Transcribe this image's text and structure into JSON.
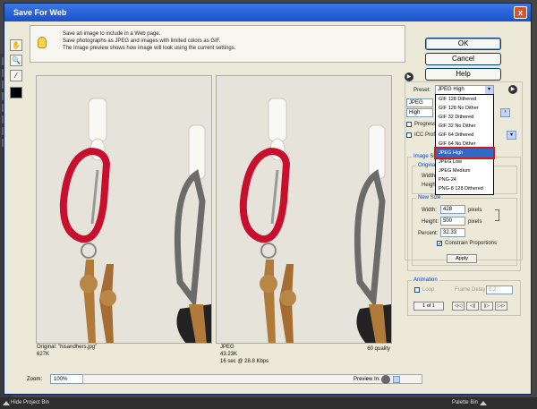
{
  "app": {
    "bottom_left": "Hide Project Bin",
    "bottom_right": "Palette Bin"
  },
  "dialog": {
    "title": "Save For Web",
    "close_glyph": "x",
    "hint_lines": [
      "Save an image to include in a Web page.",
      "Save photographs as JPEG and images with limited colors as GIF.",
      "The Image preview shows how image will look using the current settings."
    ]
  },
  "buttons": {
    "ok": "OK",
    "cancel": "Cancel",
    "help": "Help"
  },
  "preview": {
    "original": {
      "name": "Original: \"hisandhers.jpg\"",
      "size": "627K"
    },
    "optimized": {
      "format": "JPEG",
      "size": "43.23K",
      "time": "16 sec @ 28.8 Kbps",
      "quality": "60 quality"
    }
  },
  "zoom": {
    "label": "Zoom:",
    "value": "100%"
  },
  "preview_in": {
    "label": "Preview In:"
  },
  "preset": {
    "label": "Preset:",
    "value": "JPEG High",
    "format_value": "JPEG",
    "quality_value": "High",
    "progressive_label": "Progressive",
    "icc_label": "ICC Profile",
    "options": [
      "GIF 128 Dithered",
      "GIF 128 No Dither",
      "GIF 32 Dithered",
      "GIF 32 No Dither",
      "GIF 64 Dithered",
      "GIF 64 No Dither",
      "JPEG High",
      "JPEG Low",
      "JPEG Medium",
      "PNG-24",
      "PNG-8 128 Dithered"
    ],
    "selected_index": 6
  },
  "image_size": {
    "title": "Image Size",
    "original_group": "Original",
    "width_label": "Width",
    "height_label": "Height",
    "new_size_group": "New Size",
    "new_width_label": "Width:",
    "new_width": "428",
    "new_height_label": "Height:",
    "new_height": "500",
    "unit": "pixels",
    "percent_label": "Percent:",
    "percent": "32.33",
    "constrain_label": "Constrain Proportions",
    "apply": "Apply"
  },
  "animation": {
    "title": "Animation",
    "loop_label": "Loop",
    "frame_delay_label": "Frame Delay:",
    "frame_delay_value": "0.2",
    "frame_counter": "1 of 1",
    "controls": [
      "◁◁",
      "◁|",
      "|▷",
      "▷▷"
    ]
  },
  "colors": {
    "title_start": "#3b78e7",
    "title_end": "#1a50c8",
    "highlight": "#316ac5",
    "annotation": "#d11a1a"
  }
}
